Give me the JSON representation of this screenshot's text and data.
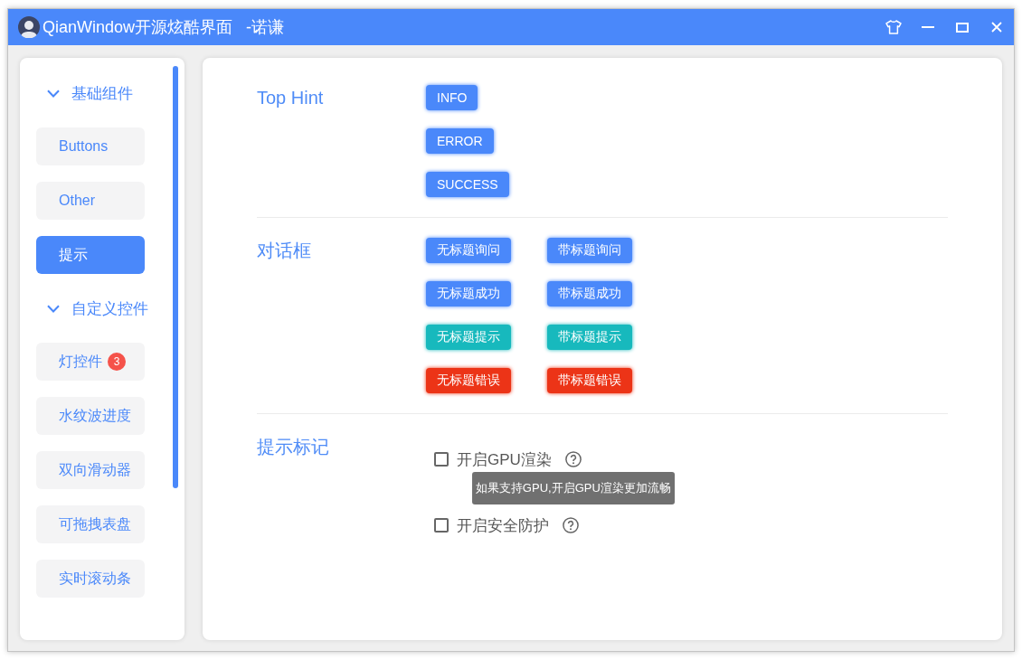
{
  "window": {
    "title": "QianWindow开源炫酷界面",
    "author": "-诺谦"
  },
  "sidebar": {
    "groups": [
      {
        "label": "基础组件",
        "expanded": true,
        "items": [
          {
            "label": "Buttons",
            "selected": false
          },
          {
            "label": "Other",
            "selected": false
          },
          {
            "label": "提示",
            "selected": true
          }
        ]
      },
      {
        "label": "自定义控件",
        "expanded": true,
        "items": [
          {
            "label": "灯控件",
            "selected": false,
            "badge": "3"
          },
          {
            "label": "水纹波进度",
            "selected": false
          },
          {
            "label": "双向滑动器",
            "selected": false
          },
          {
            "label": "可拖拽表盘",
            "selected": false
          },
          {
            "label": "实时滚动条",
            "selected": false
          }
        ]
      }
    ]
  },
  "content": {
    "sections": [
      {
        "title": "Top Hint",
        "kind": "button-column",
        "buttons": [
          {
            "label": "INFO"
          },
          {
            "label": "ERROR"
          },
          {
            "label": "SUCCESS"
          }
        ]
      },
      {
        "title": "对话框",
        "kind": "button-grid",
        "buttons": [
          {
            "label": "无标题询问",
            "color": "#4a88fa"
          },
          {
            "label": "带标题询问",
            "color": "#4a88fa"
          },
          {
            "label": "无标题成功",
            "color": "#4a88fa"
          },
          {
            "label": "带标题成功",
            "color": "#4a88fa"
          },
          {
            "label": "无标题提示",
            "color": "#17b9bd"
          },
          {
            "label": "带标题提示",
            "color": "#17b9bd"
          },
          {
            "label": "无标题错误",
            "color": "#ec3417"
          },
          {
            "label": "带标题错误",
            "color": "#ec3417"
          }
        ]
      },
      {
        "title": "提示标记",
        "kind": "checkbox-list",
        "options": [
          {
            "label": "开启GPU渲染",
            "checked": false,
            "tooltip": "如果支持GPU,开启GPU渲染更加流畅"
          },
          {
            "label": "开启安全防护",
            "checked": false
          }
        ]
      }
    ]
  }
}
